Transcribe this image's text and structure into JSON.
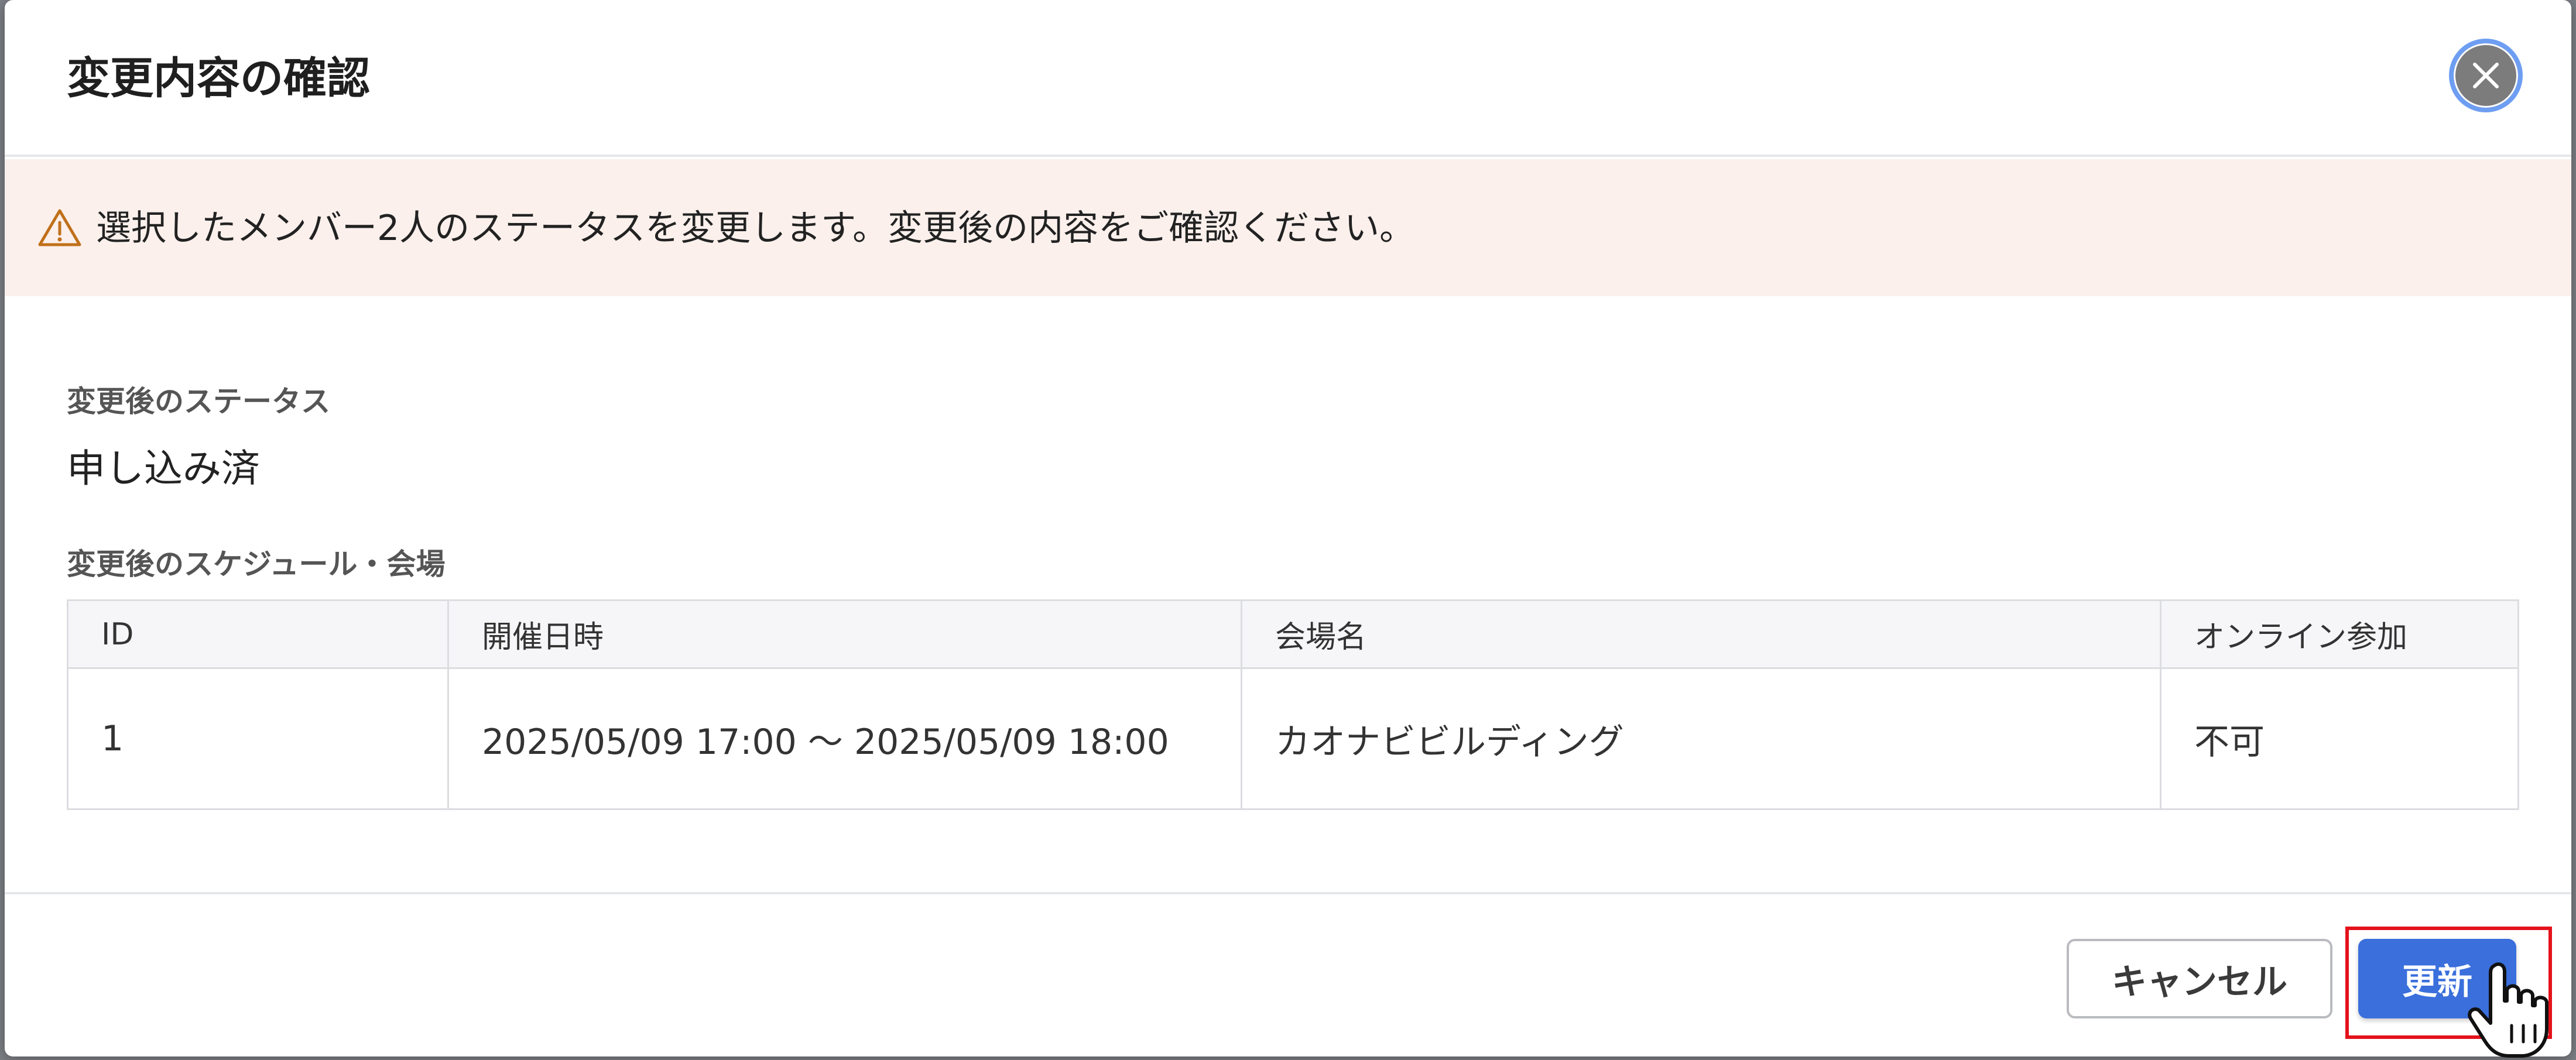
{
  "dialog": {
    "title": "変更内容の確認",
    "close_icon": "close-icon"
  },
  "alert": {
    "icon": "warning-triangle-icon",
    "message": "選択したメンバー2人のステータスを変更します。変更後の内容をご確認ください。",
    "icon_color": "#c0701a",
    "background": "#fbf0ec"
  },
  "status": {
    "label": "変更後のステータス",
    "value": "申し込み済"
  },
  "schedule": {
    "label": "変更後のスケジュール・会場",
    "columns": [
      "ID",
      "開催日時",
      "会場名",
      "オンライン参加"
    ],
    "rows": [
      [
        "1",
        "2025/05/09 17:00 〜 2025/05/09 18:00",
        "カオナビビルディング",
        "不可"
      ]
    ]
  },
  "footer": {
    "cancel_label": "キャンセル",
    "update_label": "更新",
    "primary_color": "#3a6fdc"
  },
  "overlay": {
    "highlight_color": "#e3121b",
    "cursor_icon": "hand-pointer-icon"
  }
}
